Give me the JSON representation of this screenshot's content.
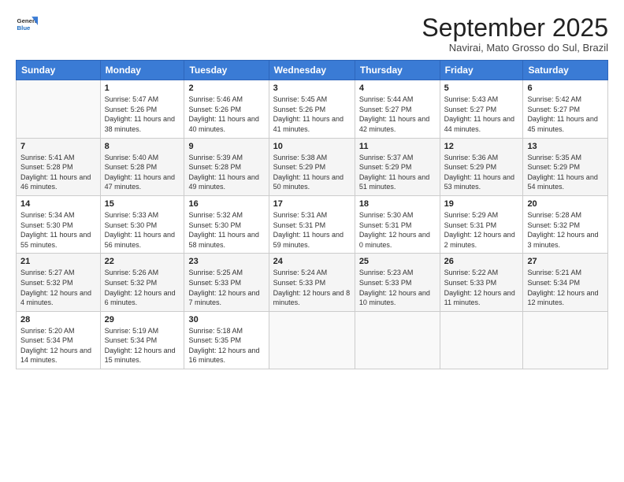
{
  "header": {
    "logo": {
      "general": "General",
      "blue": "Blue"
    },
    "title": "September 2025",
    "location": "Navirai, Mato Grosso do Sul, Brazil"
  },
  "weekdays": [
    "Sunday",
    "Monday",
    "Tuesday",
    "Wednesday",
    "Thursday",
    "Friday",
    "Saturday"
  ],
  "weeks": [
    [
      {
        "day": "",
        "sunrise": "",
        "sunset": "",
        "daylight": ""
      },
      {
        "day": "1",
        "sunrise": "5:47 AM",
        "sunset": "5:26 PM",
        "daylight": "11 hours and 38 minutes."
      },
      {
        "day": "2",
        "sunrise": "5:46 AM",
        "sunset": "5:26 PM",
        "daylight": "11 hours and 40 minutes."
      },
      {
        "day": "3",
        "sunrise": "5:45 AM",
        "sunset": "5:26 PM",
        "daylight": "11 hours and 41 minutes."
      },
      {
        "day": "4",
        "sunrise": "5:44 AM",
        "sunset": "5:27 PM",
        "daylight": "11 hours and 42 minutes."
      },
      {
        "day": "5",
        "sunrise": "5:43 AM",
        "sunset": "5:27 PM",
        "daylight": "11 hours and 44 minutes."
      },
      {
        "day": "6",
        "sunrise": "5:42 AM",
        "sunset": "5:27 PM",
        "daylight": "11 hours and 45 minutes."
      }
    ],
    [
      {
        "day": "7",
        "sunrise": "5:41 AM",
        "sunset": "5:28 PM",
        "daylight": "11 hours and 46 minutes."
      },
      {
        "day": "8",
        "sunrise": "5:40 AM",
        "sunset": "5:28 PM",
        "daylight": "11 hours and 47 minutes."
      },
      {
        "day": "9",
        "sunrise": "5:39 AM",
        "sunset": "5:28 PM",
        "daylight": "11 hours and 49 minutes."
      },
      {
        "day": "10",
        "sunrise": "5:38 AM",
        "sunset": "5:29 PM",
        "daylight": "11 hours and 50 minutes."
      },
      {
        "day": "11",
        "sunrise": "5:37 AM",
        "sunset": "5:29 PM",
        "daylight": "11 hours and 51 minutes."
      },
      {
        "day": "12",
        "sunrise": "5:36 AM",
        "sunset": "5:29 PM",
        "daylight": "11 hours and 53 minutes."
      },
      {
        "day": "13",
        "sunrise": "5:35 AM",
        "sunset": "5:29 PM",
        "daylight": "11 hours and 54 minutes."
      }
    ],
    [
      {
        "day": "14",
        "sunrise": "5:34 AM",
        "sunset": "5:30 PM",
        "daylight": "11 hours and 55 minutes."
      },
      {
        "day": "15",
        "sunrise": "5:33 AM",
        "sunset": "5:30 PM",
        "daylight": "11 hours and 56 minutes."
      },
      {
        "day": "16",
        "sunrise": "5:32 AM",
        "sunset": "5:30 PM",
        "daylight": "11 hours and 58 minutes."
      },
      {
        "day": "17",
        "sunrise": "5:31 AM",
        "sunset": "5:31 PM",
        "daylight": "11 hours and 59 minutes."
      },
      {
        "day": "18",
        "sunrise": "5:30 AM",
        "sunset": "5:31 PM",
        "daylight": "12 hours and 0 minutes."
      },
      {
        "day": "19",
        "sunrise": "5:29 AM",
        "sunset": "5:31 PM",
        "daylight": "12 hours and 2 minutes."
      },
      {
        "day": "20",
        "sunrise": "5:28 AM",
        "sunset": "5:32 PM",
        "daylight": "12 hours and 3 minutes."
      }
    ],
    [
      {
        "day": "21",
        "sunrise": "5:27 AM",
        "sunset": "5:32 PM",
        "daylight": "12 hours and 4 minutes."
      },
      {
        "day": "22",
        "sunrise": "5:26 AM",
        "sunset": "5:32 PM",
        "daylight": "12 hours and 6 minutes."
      },
      {
        "day": "23",
        "sunrise": "5:25 AM",
        "sunset": "5:33 PM",
        "daylight": "12 hours and 7 minutes."
      },
      {
        "day": "24",
        "sunrise": "5:24 AM",
        "sunset": "5:33 PM",
        "daylight": "12 hours and 8 minutes."
      },
      {
        "day": "25",
        "sunrise": "5:23 AM",
        "sunset": "5:33 PM",
        "daylight": "12 hours and 10 minutes."
      },
      {
        "day": "26",
        "sunrise": "5:22 AM",
        "sunset": "5:33 PM",
        "daylight": "12 hours and 11 minutes."
      },
      {
        "day": "27",
        "sunrise": "5:21 AM",
        "sunset": "5:34 PM",
        "daylight": "12 hours and 12 minutes."
      }
    ],
    [
      {
        "day": "28",
        "sunrise": "5:20 AM",
        "sunset": "5:34 PM",
        "daylight": "12 hours and 14 minutes."
      },
      {
        "day": "29",
        "sunrise": "5:19 AM",
        "sunset": "5:34 PM",
        "daylight": "12 hours and 15 minutes."
      },
      {
        "day": "30",
        "sunrise": "5:18 AM",
        "sunset": "5:35 PM",
        "daylight": "12 hours and 16 minutes."
      },
      {
        "day": "",
        "sunrise": "",
        "sunset": "",
        "daylight": ""
      },
      {
        "day": "",
        "sunrise": "",
        "sunset": "",
        "daylight": ""
      },
      {
        "day": "",
        "sunrise": "",
        "sunset": "",
        "daylight": ""
      },
      {
        "day": "",
        "sunrise": "",
        "sunset": "",
        "daylight": ""
      }
    ]
  ],
  "labels": {
    "sunrise_prefix": "Sunrise: ",
    "sunset_prefix": "Sunset: ",
    "daylight_prefix": "Daylight: "
  }
}
